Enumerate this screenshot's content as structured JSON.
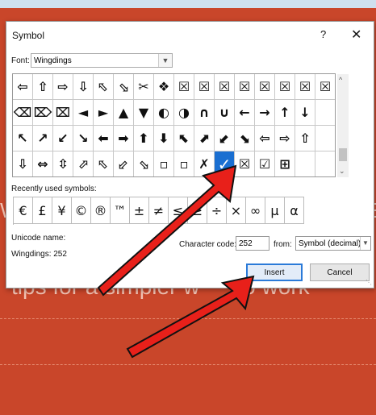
{
  "dialog": {
    "title": "Symbol",
    "help": "?",
    "close": "✕",
    "font_label": "Font:",
    "font_value": "Wingdings",
    "recently_used_label": "Recently used symbols:",
    "unicode_name_label": "Unicode name:",
    "unicode_name_value": "Wingdings: 252",
    "character_code_label": "Character code:",
    "character_code_value": "252",
    "from_label": "from:",
    "from_value": "Symbol (decimal)",
    "insert_label": "Insert",
    "cancel_label": "Cancel"
  },
  "symbol_grid": [
    [
      "⇦",
      "⇧",
      "⇨",
      "⇩",
      "⬁",
      "⬂",
      "✂",
      "❖",
      "☒",
      "☒",
      "☒",
      "☒",
      "☒",
      "☒",
      "☒",
      "☒"
    ],
    [
      "⌫",
      "⌦",
      "⌧",
      "◄",
      "►",
      "▲",
      "▼",
      "◐",
      "◑",
      "∩",
      "∪",
      "←",
      "→",
      "↑",
      "↓",
      ""
    ],
    [
      "↖",
      "↗",
      "↙",
      "↘",
      "⬅",
      "➡",
      "⬆",
      "⬇",
      "⬉",
      "⬈",
      "⬋",
      "⬊",
      "⇦",
      "⇨",
      "⇧",
      ""
    ],
    [
      "⇩",
      "⇔",
      "⇳",
      "⬀",
      "⬁",
      "⬃",
      "⬂",
      "▫",
      "▫",
      "✗",
      "✓",
      "☒",
      "☑",
      "⊞",
      "",
      ""
    ]
  ],
  "grid_selected": {
    "row": 3,
    "col": 10
  },
  "recent_symbols": [
    "€",
    "£",
    "¥",
    "©",
    "®",
    "™",
    "±",
    "≠",
    "≤",
    "≥",
    "÷",
    "×",
    "∞",
    "µ",
    "α"
  ],
  "slide": {
    "title_fragment": "tips for a simpler w",
    "title_fragment2": "to work"
  },
  "colors": {
    "slide_bg": "#c9462a",
    "selection": "#1a6fd1",
    "arrow_fill": "#e8201a"
  }
}
